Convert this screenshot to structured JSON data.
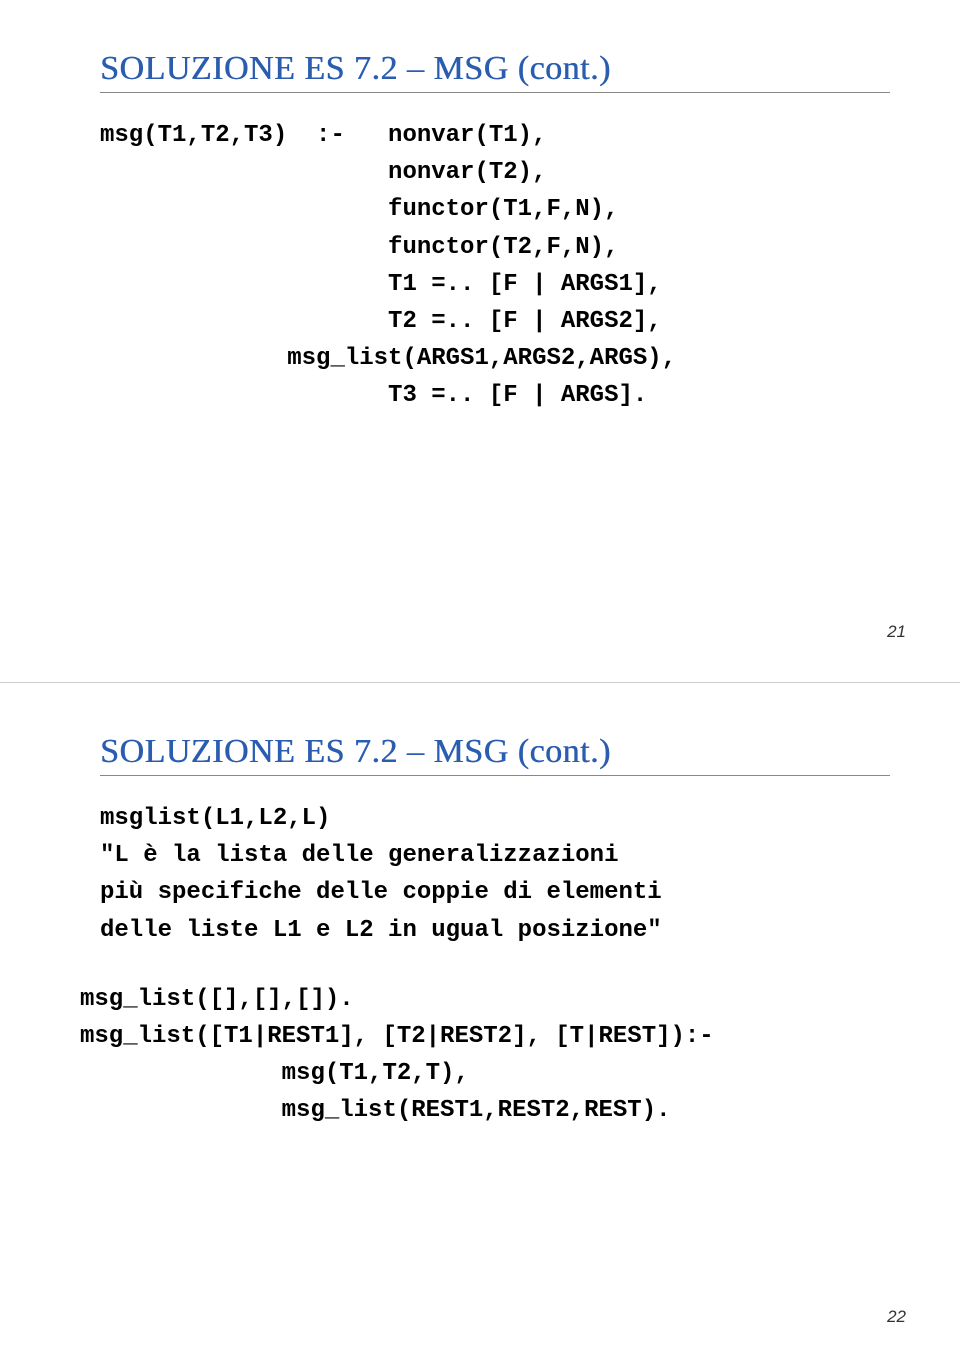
{
  "slide1": {
    "title": "SOLUZIONE ES 7.2 – MSG (cont.)",
    "code": "msg(T1,T2,T3)  :-   nonvar(T1),\n                    nonvar(T2),\n                    functor(T1,F,N),\n                    functor(T2,F,N),\n                    T1 =.. [F | ARGS1],\n                    T2 =.. [F | ARGS2],\n             msg_list(ARGS1,ARGS2,ARGS),\n                    T3 =.. [F | ARGS].",
    "page_number": "21"
  },
  "slide2": {
    "title": "SOLUZIONE ES 7.2 – MSG (cont.)",
    "msglist_head": "msglist(L1,L2,L)",
    "desc_line1": "\"L è la lista delle generalizzazioni",
    "desc_line2": "più specifiche delle coppie di elementi",
    "desc_line3": "delle liste L1 e L2 in ugual posizione\"",
    "code": "msg_list([],[],[]).\nmsg_list([T1|REST1], [T2|REST2], [T|REST]):-\n              msg(T1,T2,T),\n              msg_list(REST1,REST2,REST).",
    "page_number": "22"
  }
}
